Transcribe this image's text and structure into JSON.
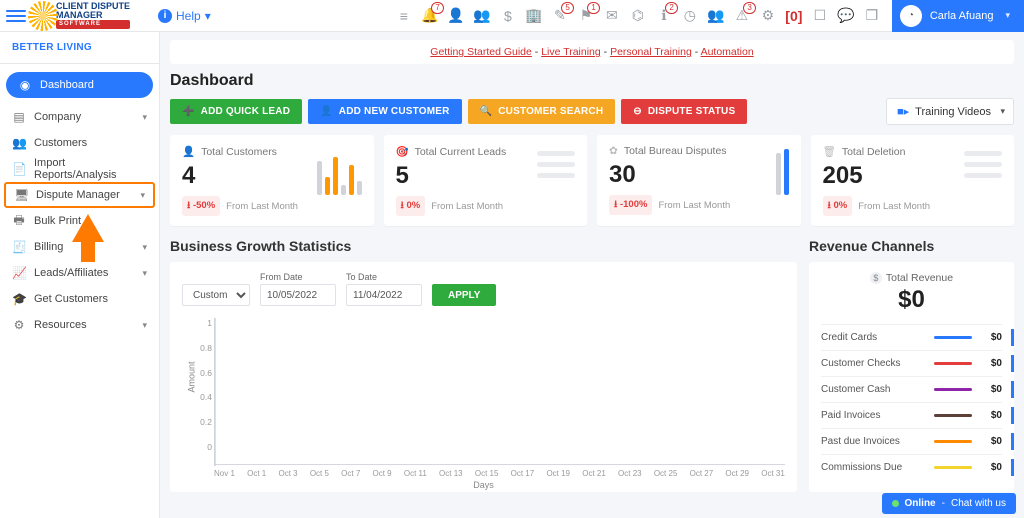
{
  "org": "BETTER LIVING",
  "help_label": "Help",
  "user_name": "Carla Afuang",
  "top_badges": [
    "7",
    "5",
    "1",
    "2",
    "3"
  ],
  "top_red_label": "[0]",
  "sidebar": {
    "items": [
      {
        "label": "Dashboard",
        "icon": "◉",
        "active": true
      },
      {
        "label": "Company",
        "icon": "▤",
        "chev": true
      },
      {
        "label": "Customers",
        "icon": "👥"
      },
      {
        "label": "Import Reports/Analysis",
        "icon": "📄"
      },
      {
        "label": "Dispute Manager",
        "icon": "🖥",
        "chev": true,
        "highlight": true
      },
      {
        "label": "Bulk Print",
        "icon": "🖶"
      },
      {
        "label": "Billing",
        "icon": "🧾",
        "chev": true
      },
      {
        "label": "Leads/Affiliates",
        "icon": "📈",
        "chev": true
      },
      {
        "label": "Get Customers",
        "icon": "🎓"
      },
      {
        "label": "Resources",
        "icon": "⚙",
        "chev": true
      }
    ]
  },
  "banner": {
    "links": [
      "Getting Started Guide",
      "Live Training",
      "Personal Training",
      "Automation"
    ],
    "sep": " - "
  },
  "dashboard_title": "Dashboard",
  "buttons": {
    "quick_lead": "ADD QUICK LEAD",
    "new_customer": "ADD NEW CUSTOMER",
    "customer_search": "CUSTOMER SEARCH",
    "dispute_status": "DISPUTE STATUS"
  },
  "training_videos_label": "Training Videos",
  "cards": [
    {
      "title": "Total Customers",
      "icon": "👤",
      "value": "4",
      "delta": "-50%",
      "foot": "From Last Month",
      "style": "bars",
      "bars": [
        [
          "#d0d3d8",
          34
        ],
        [
          "#ff9800",
          18
        ],
        [
          "#ff9800",
          38
        ],
        [
          "#d0d3d8",
          10
        ],
        [
          "#ff9800",
          30
        ],
        [
          "#d0d3d8",
          14
        ]
      ]
    },
    {
      "title": "Total Current Leads",
      "icon": "🎯",
      "value": "5",
      "delta": "0%",
      "foot": "From Last Month",
      "style": "lines"
    },
    {
      "title": "Total Bureau Disputes",
      "icon": "✿",
      "value": "30",
      "delta": "-100%",
      "foot": "From Last Month",
      "style": "twobars",
      "bars": [
        [
          "#d0d3d8",
          42
        ],
        [
          "#2979ff",
          46
        ]
      ]
    },
    {
      "title": "Total Deletion",
      "icon": "🗑",
      "value": "205",
      "delta": "0%",
      "foot": "From Last Month",
      "style": "lines"
    }
  ],
  "growth": {
    "title": "Business Growth Statistics",
    "range_sel": "Custom",
    "from_label": "From Date",
    "to_label": "To Date",
    "from": "10/05/2022",
    "to": "11/04/2022",
    "apply": "APPLY",
    "ylabel": "Amount",
    "xlabel": "Days"
  },
  "chart_data": {
    "type": "line",
    "title": "Business Growth Statistics",
    "xlabel": "Days",
    "ylabel": "Amount",
    "ylim": [
      0,
      1
    ],
    "yticks": [
      0,
      0.2,
      0.4,
      0.6,
      0.8,
      1
    ],
    "categories": [
      "Nov 1",
      "Oct 1",
      "Oct 3",
      "Oct 5",
      "Oct 7",
      "Oct 9",
      "Oct 11",
      "Oct 13",
      "Oct 15",
      "Oct 17",
      "Oct 19",
      "Oct 21",
      "Oct 23",
      "Oct 25",
      "Oct 27",
      "Oct 29",
      "Oct 31"
    ],
    "series": [
      {
        "name": "Amount",
        "values": [
          0,
          0,
          0,
          0,
          0,
          0,
          0,
          0,
          0,
          0,
          0,
          0,
          0,
          0,
          0,
          0,
          0
        ]
      }
    ]
  },
  "revenue": {
    "title": "Revenue Channels",
    "total_label": "Total Revenue",
    "total_value": "$0",
    "channels": [
      {
        "name": "Credit Cards",
        "color": "#2979ff",
        "value": "$0"
      },
      {
        "name": "Customer Checks",
        "color": "#e23c3c",
        "value": "$0"
      },
      {
        "name": "Customer Cash",
        "color": "#8e24aa",
        "value": "$0"
      },
      {
        "name": "Paid Invoices",
        "color": "#5d4037",
        "value": "$0"
      },
      {
        "name": "Past due Invoices",
        "color": "#ff8a00",
        "value": "$0"
      },
      {
        "name": "Commissions Due",
        "color": "#f3d42e",
        "value": "$0"
      }
    ]
  },
  "chat": {
    "status": "Online",
    "msg": "Chat with us"
  }
}
